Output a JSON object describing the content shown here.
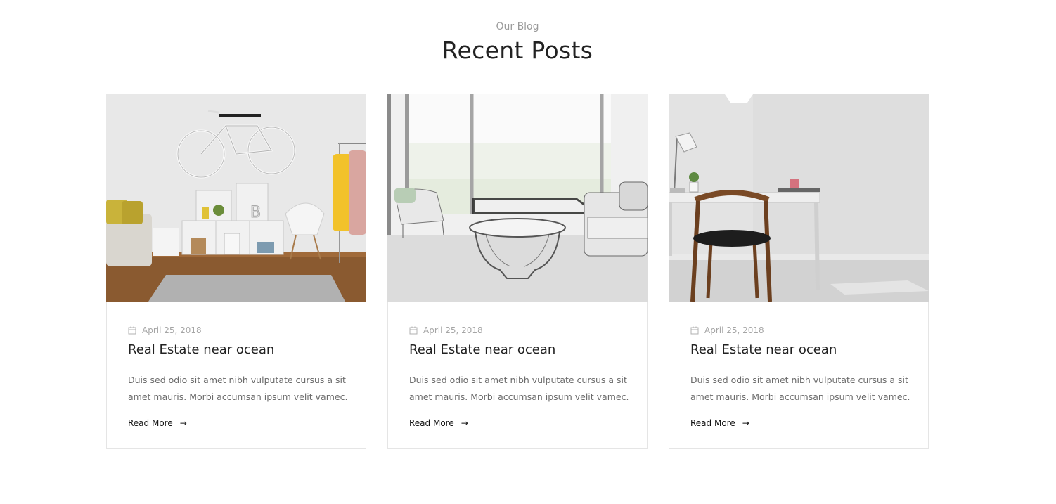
{
  "section": {
    "subtitle": "Our Blog",
    "title": "Recent Posts"
  },
  "posts": [
    {
      "date": "April 25, 2018",
      "title": "Real Estate near ocean",
      "excerpt": "Duis sed odio sit amet nibh vulputate cursus a sit amet mauris. Morbi accumsan ipsum velit vamec.",
      "read_more": "Read More",
      "image": "living-room-bicycle-photo"
    },
    {
      "date": "April 25, 2018",
      "title": "Real Estate near ocean",
      "excerpt": "Duis sed odio sit amet nibh vulputate cursus a sit amet mauris. Morbi accumsan ipsum velit vamec.",
      "read_more": "Read More",
      "image": "sketch-living-room-photo"
    },
    {
      "date": "April 25, 2018",
      "title": "Real Estate near ocean",
      "excerpt": "Duis sed odio sit amet nibh vulputate cursus a sit amet mauris. Morbi accumsan ipsum velit vamec.",
      "read_more": "Read More",
      "image": "desk-chair-photo"
    }
  ],
  "icons": {
    "date": "calendar-icon",
    "read_more": "arrow-right-icon"
  },
  "colors": {
    "heading": "#222222",
    "muted": "#a5a5a5",
    "border": "#e5e5e5"
  }
}
